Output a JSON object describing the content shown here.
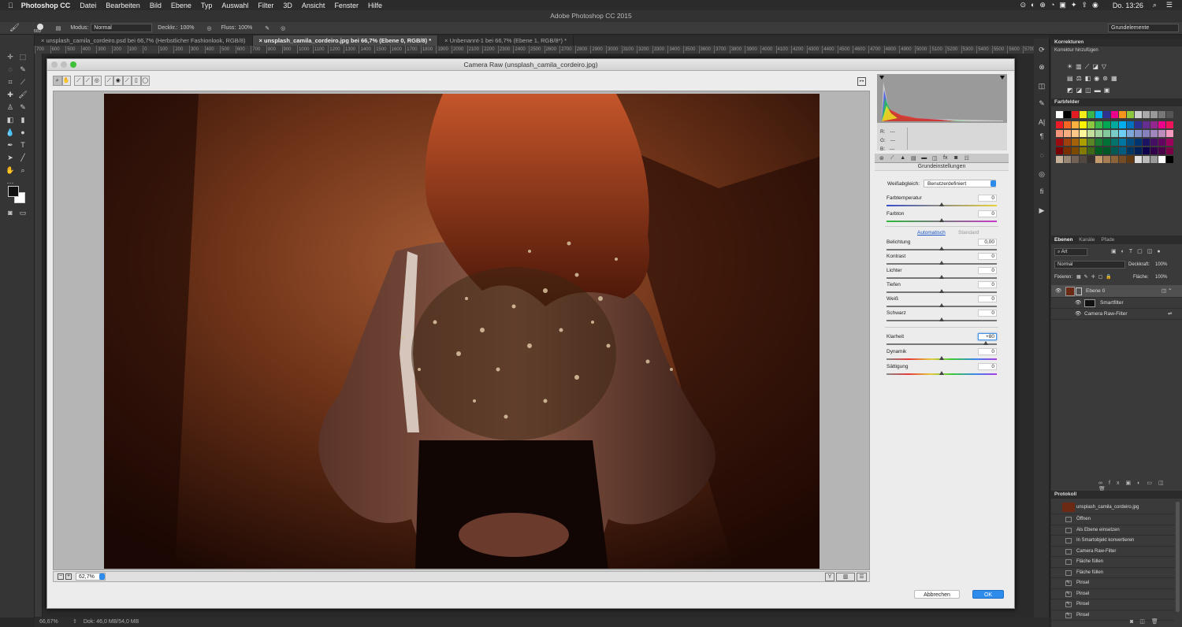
{
  "menubar": {
    "app": "Photoshop CC",
    "items": [
      "Datei",
      "Bearbeiten",
      "Bild",
      "Ebene",
      "Typ",
      "Auswahl",
      "Filter",
      "3D",
      "Ansicht",
      "Fenster",
      "Hilfe"
    ],
    "clock": "Do. 13:26"
  },
  "window_title": "Adobe Photoshop CC 2015",
  "options": {
    "brush_size": "669",
    "modus_label": "Modus:",
    "modus_value": "Normal",
    "deckkr_label": "Deckkr.:",
    "deckkr_value": "100%",
    "fluss_label": "Fluss:",
    "fluss_value": "100%",
    "workspace": "Grundelemente"
  },
  "doc_tabs": [
    "unsplash_camila_cordeiro.psd bei 66,7% (Herbstlicher Fashionlook, RGB/8)",
    "unsplash_camila_cordeiro.jpg bei 66,7% (Ebene 0, RGB/8) *",
    "Unbenannt-1 bei 66,7% (Ebene 1, RGB/8*) *"
  ],
  "ruler_marks": [
    "700",
    "600",
    "500",
    "400",
    "300",
    "200",
    "100",
    "0",
    "100",
    "200",
    "300",
    "400",
    "500",
    "600",
    "700",
    "800",
    "900",
    "1000",
    "1100",
    "1200",
    "1300",
    "1400",
    "1500",
    "1600",
    "1700",
    "1800",
    "1900",
    "2000",
    "2100",
    "2200",
    "2300",
    "2400",
    "2500",
    "2600",
    "2700",
    "2800",
    "2900",
    "3000",
    "3100",
    "3200",
    "3300",
    "3400",
    "3500",
    "3600",
    "3700",
    "3800",
    "3900",
    "4000",
    "4100",
    "4200",
    "4300",
    "4400",
    "4500",
    "4600",
    "4700",
    "4800",
    "4900",
    "5000",
    "5100",
    "5200",
    "5300",
    "5400",
    "5500",
    "5600",
    "5700"
  ],
  "status": {
    "zoom": "66,67%",
    "doc": "Dok: 46,0 MB/54,0 MB"
  },
  "camera_raw": {
    "title": "Camera Raw (unsplash_camila_cordeiro.jpg)",
    "zoom": "62,7%",
    "rgb": {
      "r_label": "R:",
      "g_label": "G:",
      "b_label": "B:",
      "r": "---",
      "g": "---",
      "b": "---"
    },
    "section_title": "Grundeinstellungen",
    "wb_label": "Weißabgleich:",
    "wb_value": "Benutzerdefiniert",
    "auto_link": "Automatisch",
    "standard_link": "Standard",
    "sliders": [
      {
        "label": "Farbtemperatur",
        "value": "0",
        "pos": 0.5
      },
      {
        "label": "Farbton",
        "value": "0",
        "pos": 0.5
      },
      {
        "label": "Belichtung",
        "value": "0,00",
        "pos": 0.5
      },
      {
        "label": "Kontrast",
        "value": "0",
        "pos": 0.5
      },
      {
        "label": "Lichter",
        "value": "0",
        "pos": 0.5
      },
      {
        "label": "Tiefen",
        "value": "0",
        "pos": 0.5
      },
      {
        "label": "Weiß",
        "value": "0",
        "pos": 0.5
      },
      {
        "label": "Schwarz",
        "value": "0",
        "pos": 0.5
      },
      {
        "label": "Klarheit",
        "value": "+80",
        "pos": 0.9
      },
      {
        "label": "Dynamik",
        "value": "0",
        "pos": 0.5
      },
      {
        "label": "Sättigung",
        "value": "0",
        "pos": 0.5
      }
    ],
    "cancel": "Abbrechen",
    "ok": "OK"
  },
  "panels": {
    "korrekturen": "Korrekturen",
    "korrektur_add": "Korrektur hinzufügen",
    "farbfelder": "Farbfelder",
    "ebenen_tabs": [
      "Ebenen",
      "Kanäle",
      "Pfade"
    ],
    "art": "Art",
    "blend": "Normal",
    "deckkraft_label": "Deckkraft:",
    "deckkraft": "100%",
    "fixieren": "Fixieren:",
    "flaeche_label": "Fläche:",
    "flaeche": "100%",
    "layers": [
      "Ebene 0",
      "Smartfilter",
      "Camera Raw-Filter"
    ],
    "protokoll": "Protokoll",
    "history": [
      "unsplash_camila_cordeiro.jpg",
      "Öffnen",
      "Als Ebene einsetzen",
      "In Smartobjekt konvertieren",
      "Camera Raw-Filter",
      "Fläche füllen",
      "Fläche füllen",
      "Pinsel",
      "Pinsel",
      "Pinsel",
      "Pinsel"
    ]
  },
  "colors": {
    "accent": "#2d8ceb",
    "bg": "#282828",
    "dialog": "#ececec"
  }
}
